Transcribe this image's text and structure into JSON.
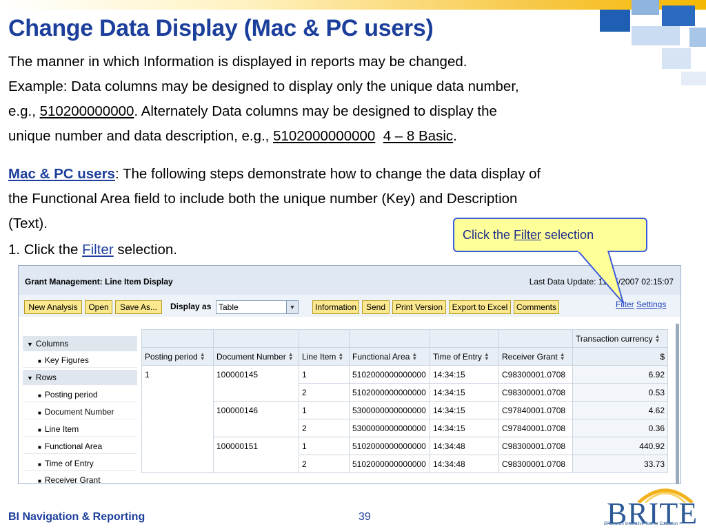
{
  "slide": {
    "title": "Change Data Display (Mac & PC users)",
    "line1": "The manner in which Information is displayed in reports may be changed.",
    "line2": "Example:  Data columns  may be designed to display only the unique data number,",
    "line3_pre": "e.g., ",
    "line3_num": "510200000000",
    "line3_post": ".  Alternately Data columns  may be designed to display the",
    "line4_pre": "unique number and data description, e.g., ",
    "line4_num": "5102000000000",
    "line4_gap": "  ",
    "line4_desc": "4 – 8 Basic",
    "line4_end": ".",
    "para2_link": "Mac & PC users",
    "para2_line1_rest": ":  The following steps demonstrate how to change the data display of",
    "para2_line2": "the Functional Area field to include both the unique number (Key) and Description",
    "para2_line3": "(Text).",
    "step1_pre": "1.  Click the ",
    "step1_link": "Filter",
    "step1_post": " selection."
  },
  "callout": {
    "pre": "Click the ",
    "link": "Filter",
    "post": " selection"
  },
  "app": {
    "title": "Grant Management: Line Item Display",
    "last_update": "Last Data Update: 11/15/2007 02:15:07",
    "toolbar": {
      "new_analysis": "New Analysis",
      "open": "Open",
      "save_as": "Save As...",
      "display_as_label": "Display as",
      "display_as_value": "Table",
      "information": "Information",
      "send": "Send",
      "print_version": "Print Version",
      "export_excel": "Export to Excel",
      "comments": "Comments",
      "filter": "Filter",
      "settings": "Settings"
    },
    "nav": {
      "columns": "Columns",
      "key_figures": "Key Figures",
      "rows": "Rows",
      "posting_period": "Posting period",
      "document_number": "Document Number",
      "line_item": "Line Item",
      "functional_area": "Functional Area",
      "time_of_entry": "Time of Entry",
      "receiver_grant": "Receiver Grant"
    },
    "table": {
      "currency_header": "Transaction currency",
      "headers": [
        "Posting period",
        "Document Number",
        "Line Item",
        "Functional Area",
        "Time of Entry",
        "Receiver Grant",
        "$"
      ],
      "rows": [
        [
          "1",
          "100000145",
          "1",
          "5102000000000000",
          "14:34:15",
          "C98300001.0708",
          "6.92"
        ],
        [
          "",
          "",
          "2",
          "5102000000000000",
          "14:34:15",
          "C98300001.0708",
          "0.53"
        ],
        [
          "",
          "100000146",
          "1",
          "5300000000000000",
          "14:34:15",
          "C97840001.0708",
          "4.62"
        ],
        [
          "",
          "",
          "2",
          "5300000000000000",
          "14:34:15",
          "C97840001.0708",
          "0.36"
        ],
        [
          "",
          "100000151",
          "1",
          "5102000000000000",
          "14:34:48",
          "C98300001.0708",
          "440.92"
        ],
        [
          "",
          "",
          "2",
          "5102000000000000",
          "14:34:48",
          "C98300001.0708",
          "33.73"
        ]
      ]
    }
  },
  "footer": {
    "left": "BI Navigation & Reporting",
    "page": "39"
  },
  "logo": {
    "text": "BRITE",
    "tagline": "BRoward's Innovative Tool for Education"
  },
  "colors": {
    "title_blue": "#1c3f9c",
    "callout_fill": "#ffff99",
    "button_yellow": "#fbe88f"
  }
}
